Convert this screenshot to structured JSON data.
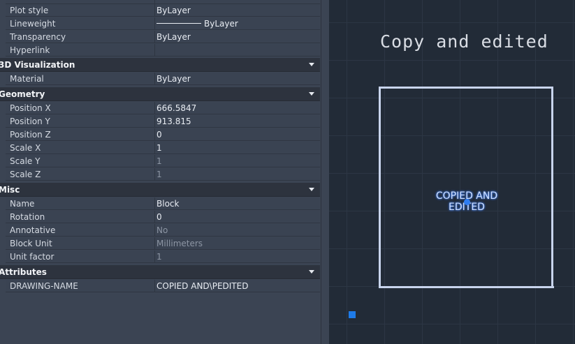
{
  "properties": {
    "general_rows": [
      {
        "label": "Plot style",
        "value": "ByLayer"
      },
      {
        "label": "Lineweight",
        "value": "ByLayer"
      },
      {
        "label": "Transparency",
        "value": "ByLayer"
      },
      {
        "label": "Hyperlink",
        "value": ""
      }
    ],
    "viz": {
      "title": "3D Visualization",
      "rows": [
        {
          "label": "Material",
          "value": "ByLayer"
        }
      ]
    },
    "geometry": {
      "title": "Geometry",
      "rows": [
        {
          "label": "Position X",
          "value": "666.5847"
        },
        {
          "label": "Position Y",
          "value": "913.815"
        },
        {
          "label": "Position Z",
          "value": "0"
        },
        {
          "label": "Scale X",
          "value": "1"
        },
        {
          "label": "Scale Y",
          "value": "1"
        },
        {
          "label": "Scale Z",
          "value": "1"
        }
      ]
    },
    "misc": {
      "title": "Misc",
      "rows": [
        {
          "label": "Name",
          "value": "Block"
        },
        {
          "label": "Rotation",
          "value": "0"
        },
        {
          "label": "Annotative",
          "value": "No"
        },
        {
          "label": "Block Unit",
          "value": "Millimeters"
        },
        {
          "label": "Unit factor",
          "value": "1"
        }
      ]
    },
    "attributes": {
      "title": "Attributes",
      "rows": [
        {
          "label": "DRAWING-NAME",
          "value": "COPIED AND\\PEDITED"
        }
      ]
    }
  },
  "canvas": {
    "title": "Copy and edited",
    "block_attribute_text": "COPIED AND\nEDITED"
  },
  "colors": {
    "canvas_bg": "#222b37",
    "palette_bg": "#3b4453",
    "section_bg": "#2d333e",
    "grip_blue": "#2f7df2",
    "block_frame": "#c8d4ec"
  }
}
